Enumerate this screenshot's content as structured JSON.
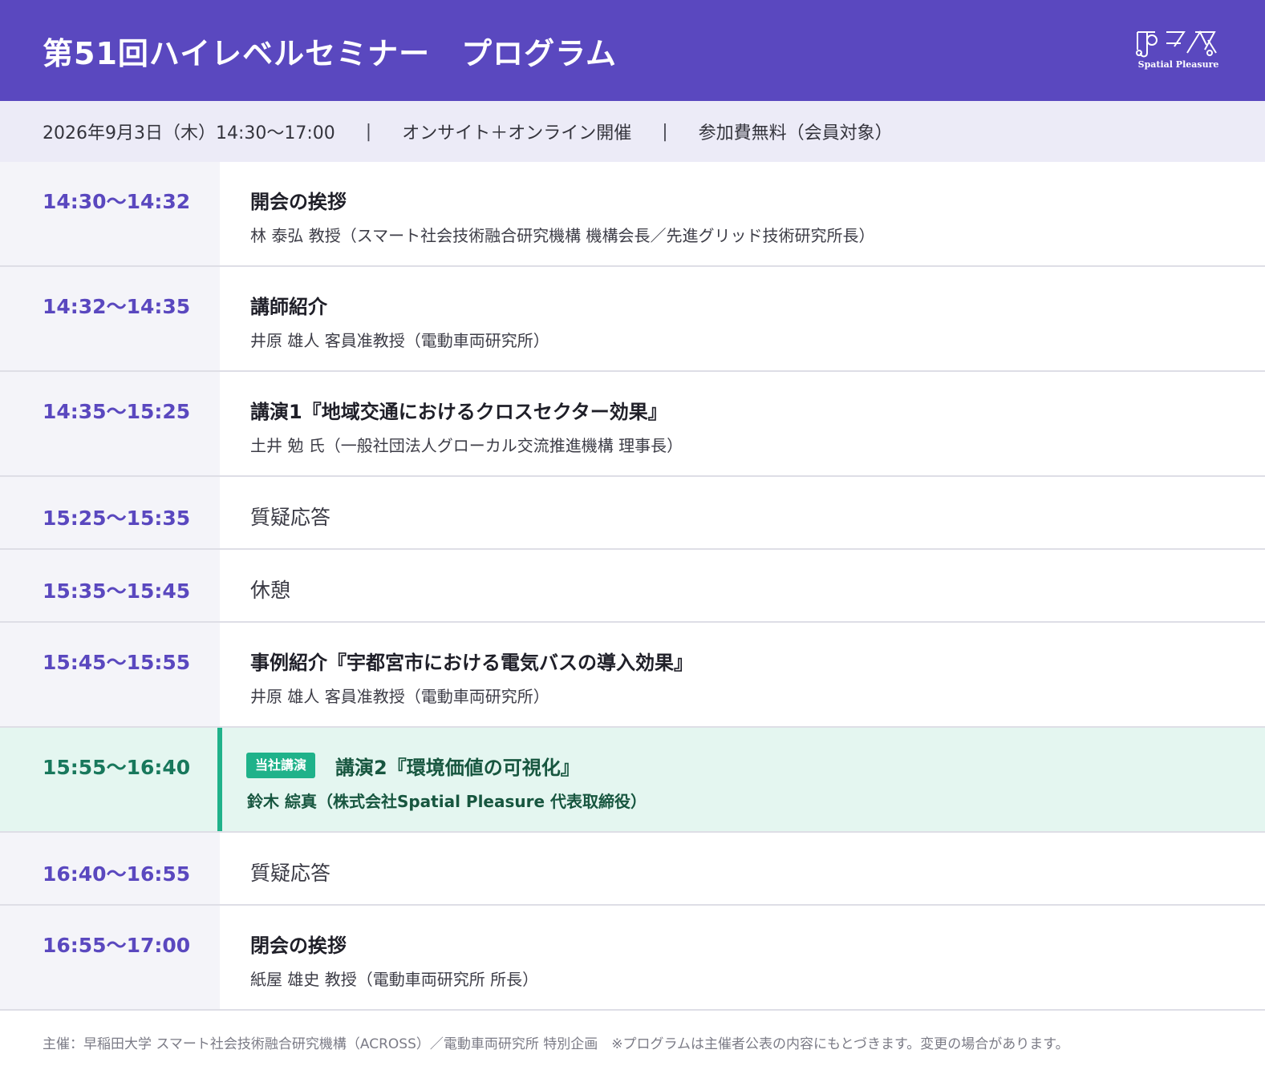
{
  "header": {
    "title": "第51回ハイレベルセミナー　プログラム",
    "logo_text": "Spatial Pleasure",
    "bg_color": "#5a48bf"
  },
  "info": {
    "datetime": "2026年9月3日（木）14:30〜17:00",
    "format": "オンサイト＋オンライン開催",
    "fee": "参加費無料（会員対象）",
    "separator": "|"
  },
  "schedule": [
    {
      "time": "14:30〜14:32",
      "title": "開会の挨拶",
      "speaker": "林 泰弘 教授（スマート社会技術融合研究機構 機構会長／先進グリッド技術研究所長）"
    },
    {
      "time": "14:32〜14:35",
      "title": "講師紹介",
      "speaker": "井原 雄人 客員准教授（電動車両研究所）"
    },
    {
      "time": "14:35〜15:25",
      "title": "講演1『地域交通におけるクロスセクター効果』",
      "speaker": "土井 勉 氏（一般社団法人グローカル交流推進機構 理事長）"
    },
    {
      "time": "15:25〜15:35",
      "title": "質疑応答"
    },
    {
      "time": "15:35〜15:45",
      "title": "休憩"
    },
    {
      "time": "15:45〜15:55",
      "title": "事例紹介『宇都宮市における電気バスの導入効果』",
      "speaker": "井原 雄人 客員准教授（電動車両研究所）"
    },
    {
      "time": "15:55〜16:40",
      "badge": "当社講演",
      "title": "講演2『環境価値の可視化』",
      "speaker": "鈴木 綜真（株式会社Spatial Pleasure 代表取締役）",
      "highlight_color": "#1fb28a"
    },
    {
      "time": "16:40〜16:55",
      "title": "質疑応答"
    },
    {
      "time": "16:55〜17:00",
      "title": "閉会の挨拶",
      "speaker": "紙屋 雄史 教授（電動車両研究所 所長）"
    }
  ],
  "footer": {
    "text": "主催：早稲田大学 スマート社会技術融合研究機構（ACROSS）／電動車両研究所 特別企画　※プログラムは主催者公表の内容にもとづきます。変更の場合があります。"
  }
}
